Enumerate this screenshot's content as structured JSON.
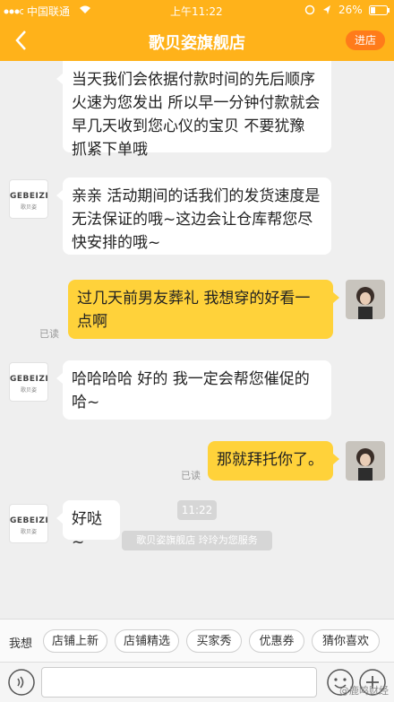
{
  "status_bar": {
    "carrier": "中国联通",
    "time": "上午11:22",
    "battery": "26%"
  },
  "header": {
    "title": "歌贝姿旗舰店",
    "store_button": "进店"
  },
  "messages": [
    {
      "side": "left",
      "text": "当天我们会依据付款时间的先后顺序火速为您发出 所以早一分钟付款就会早几天收到您心仪的宝贝 不要犹豫 抓紧下单哦"
    },
    {
      "side": "left",
      "text": "亲亲 活动期间的话我们的发货速度是无法保证的哦~这边会让仓库帮您尽快安排的哦~"
    },
    {
      "side": "right",
      "text": "过几天前男友葬礼 我想穿的好看一点啊",
      "read": "已读"
    },
    {
      "side": "left",
      "text": "哈哈哈哈 好的 我一定会帮您催促的哈~"
    },
    {
      "side": "right",
      "text": "那就拜托你了。",
      "read": "已读"
    },
    {
      "side": "left",
      "text": "好哒~"
    }
  ],
  "brand_avatar": {
    "name": "GEBEIZI",
    "sub": "歌贝姿"
  },
  "timestamp": "11:22",
  "service_notice": "歌贝姿旗舰店 玲玲为您服务",
  "quick_bar": {
    "label": "我想",
    "chips": [
      "店铺上新",
      "店铺精选",
      "买家秀",
      "优惠券",
      "猜你喜欢"
    ]
  },
  "watermark": "@鹿鸣财经",
  "colors": {
    "accent": "#ffb21a",
    "bubble_right": "#ffd23a",
    "store_button": "#ff7b1a"
  }
}
